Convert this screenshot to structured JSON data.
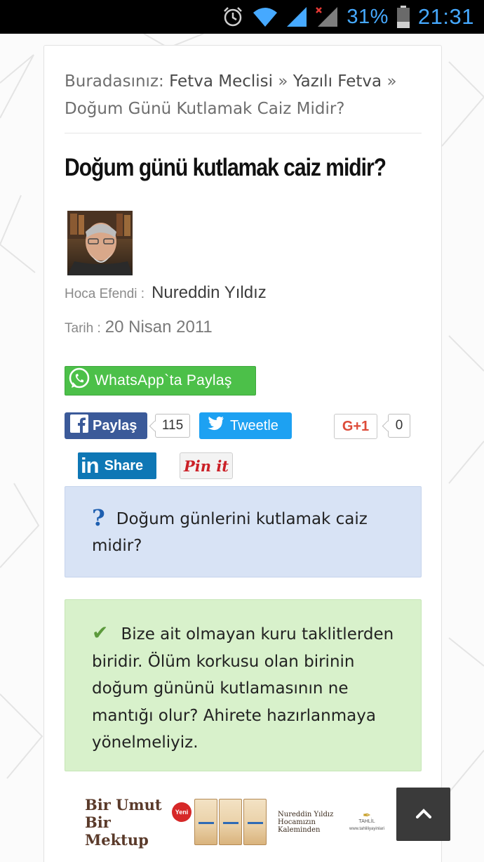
{
  "statusbar": {
    "icons": [
      "alarm-icon",
      "wifi-icon",
      "signal-icon",
      "signal-no-data-icon",
      "battery-icon"
    ],
    "battery": "31%",
    "time": "21:31"
  },
  "breadcrumb": {
    "prefix": "Buradasınız:",
    "crumb1": "Fetva Meclisi",
    "sep": "»",
    "crumb2": "Yazılı Fetva",
    "current": "Doğum Günü Kutlamak Caiz Midir?"
  },
  "article": {
    "title": "Doğum günü kutlamak caiz midir?",
    "author_label": "Hoca Efendi :",
    "author_name": "Nureddin Yıldız",
    "date_label": "Tarih :",
    "date_value": "20 Nisan 2011"
  },
  "share": {
    "whatsapp_label": "WhatsApp`ta Paylaş",
    "facebook_label": "Paylaş",
    "facebook_count": "115",
    "twitter_label": "Tweetle",
    "gplus_label": "G+1",
    "gplus_count": "0",
    "linkedin_label": "Share",
    "pinterest_label": "Pin it",
    "colors": {
      "whatsapp": "#4cc049",
      "facebook": "#3b5a99",
      "twitter": "#1da1f2",
      "gplus": "#dd4b39",
      "linkedin": "#0e77b5",
      "pinterest": "#cb2027"
    }
  },
  "question": {
    "icon": "question-mark-icon",
    "text": "Doğum günlerini kutlamak caiz midir?"
  },
  "answer": {
    "icon": "check-icon",
    "text": "Bize ait olmayan kuru taklitlerden biridir. Ölüm korkusu olan birinin doğum gününü kutlamasının ne mantığı olur? Ahirete hazırlanmaya yönelmeliyiz."
  },
  "banner": {
    "title_line1": "Bir Umut",
    "title_line2": "Bir Mektup",
    "badge": "Yeni",
    "author_line1": "Nureddin Yıldız",
    "author_line2": "Hocamızın",
    "author_line3": "Kaleminden",
    "publisher": "TAHLİL",
    "publisher_url": "www.tahliliyayinlari"
  },
  "scroll_top": {
    "icon": "chevron-up-icon"
  }
}
